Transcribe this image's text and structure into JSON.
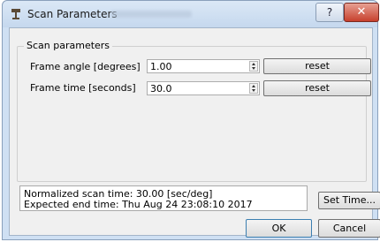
{
  "window": {
    "title": "Scan Parameters",
    "help_label": "?",
    "close_label": "✕"
  },
  "group": {
    "legend": "Scan parameters"
  },
  "params": [
    {
      "label": "Frame angle [degrees]",
      "value": "1.00",
      "reset_label": "reset"
    },
    {
      "label": "Frame time [seconds]",
      "value": "30.0",
      "reset_label": "reset"
    }
  ],
  "status": {
    "line1": "Normalized scan time: 30.00 [sec/deg]",
    "line2": "Expected end time: Thu Aug 24 23:08:10 2017"
  },
  "buttons": {
    "set_time": "Set Time...",
    "ok": "OK",
    "cancel": "Cancel"
  },
  "icons": {
    "app": "scanner-icon",
    "help": "help-icon",
    "close": "close-icon"
  }
}
